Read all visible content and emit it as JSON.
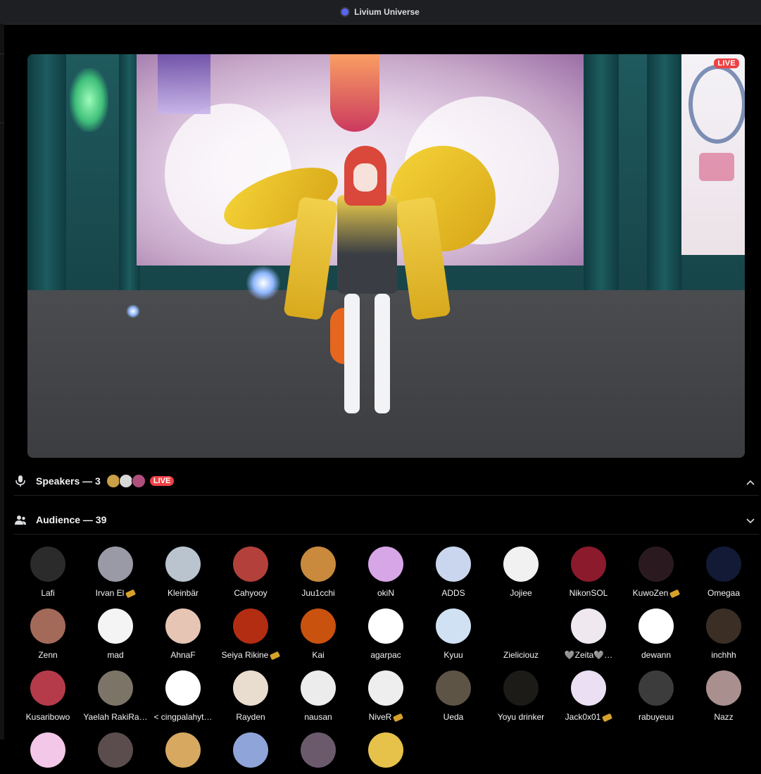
{
  "window": {
    "title": "Livium Universe"
  },
  "stage": {
    "live_badge": "LIVE"
  },
  "speakers": {
    "label": "Speakers — 3",
    "live_badge": "LIVE",
    "avatar_colors": [
      "#c9a046",
      "#d8d8d8",
      "#b04f7d"
    ]
  },
  "audience": {
    "label": "Audience — 39",
    "members": [
      {
        "name": "Lafi",
        "color": "#2b2b2b"
      },
      {
        "name": "Irvan El",
        "color": "#9a9aa6",
        "boost": true
      },
      {
        "name": "Kleinbär",
        "color": "#b9c4cf"
      },
      {
        "name": "Cahyooy",
        "color": "#b3403a"
      },
      {
        "name": "Juu1cchi",
        "color": "#c98a3d"
      },
      {
        "name": "okiN",
        "color": "#d7a6e6"
      },
      {
        "name": "ADDS",
        "color": "#c9d6ee"
      },
      {
        "name": "Jojiee",
        "color": "#f1f1f1"
      },
      {
        "name": "NikonSOL",
        "color": "#8b1b2c"
      },
      {
        "name": "KuwoZen",
        "color": "#2a1a1f",
        "boost": true
      },
      {
        "name": "Omegaa",
        "color": "#121a36"
      },
      {
        "name": "Zenn",
        "color": "#a36a5a"
      },
      {
        "name": "mad",
        "color": "#f4f4f4"
      },
      {
        "name": "AhnaF",
        "color": "#e6c5b5"
      },
      {
        "name": "Seiya Rikine",
        "color": "#b32d13",
        "boost": true
      },
      {
        "name": "Kai",
        "color": "#c9520e"
      },
      {
        "name": "agarpac",
        "color": "#ffffff"
      },
      {
        "name": "Kyuu",
        "color": "#cfe1f2"
      },
      {
        "name": "Zieliciouz",
        "color": "#000000"
      },
      {
        "name": "🩶Zeita🩶…",
        "color": "#f0e8ef"
      },
      {
        "name": "dewann",
        "color": "#ffffff"
      },
      {
        "name": "inchhh",
        "color": "#3b2f25"
      },
      {
        "name": "Kusaribowo",
        "color": "#b53b4b"
      },
      {
        "name": "Yaelah RakiRa…",
        "color": "#7d7468"
      },
      {
        "name": "< cingpalahyt…",
        "color": "#ffffff"
      },
      {
        "name": "Rayden",
        "color": "#e9ddd0"
      },
      {
        "name": "nausan",
        "color": "#ececec"
      },
      {
        "name": "NiveR",
        "color": "#eeeeee",
        "boost": true
      },
      {
        "name": "Ueda",
        "color": "#5d5446"
      },
      {
        "name": "Yoyu drinker",
        "color": "#1d1b18"
      },
      {
        "name": "Jack0x01",
        "color": "#eadff3",
        "boost": true
      },
      {
        "name": "rabuyeuu",
        "color": "#3c3c3c"
      },
      {
        "name": "Nazz",
        "color": "#a9908e"
      },
      {
        "name": "",
        "color": "#f3c7e8"
      },
      {
        "name": "",
        "color": "#5b4d4d"
      },
      {
        "name": "",
        "color": "#d6a860"
      },
      {
        "name": "",
        "color": "#8fa4d8"
      },
      {
        "name": "",
        "color": "#6b5a6c"
      },
      {
        "name": "",
        "color": "#e6c24a"
      }
    ]
  }
}
